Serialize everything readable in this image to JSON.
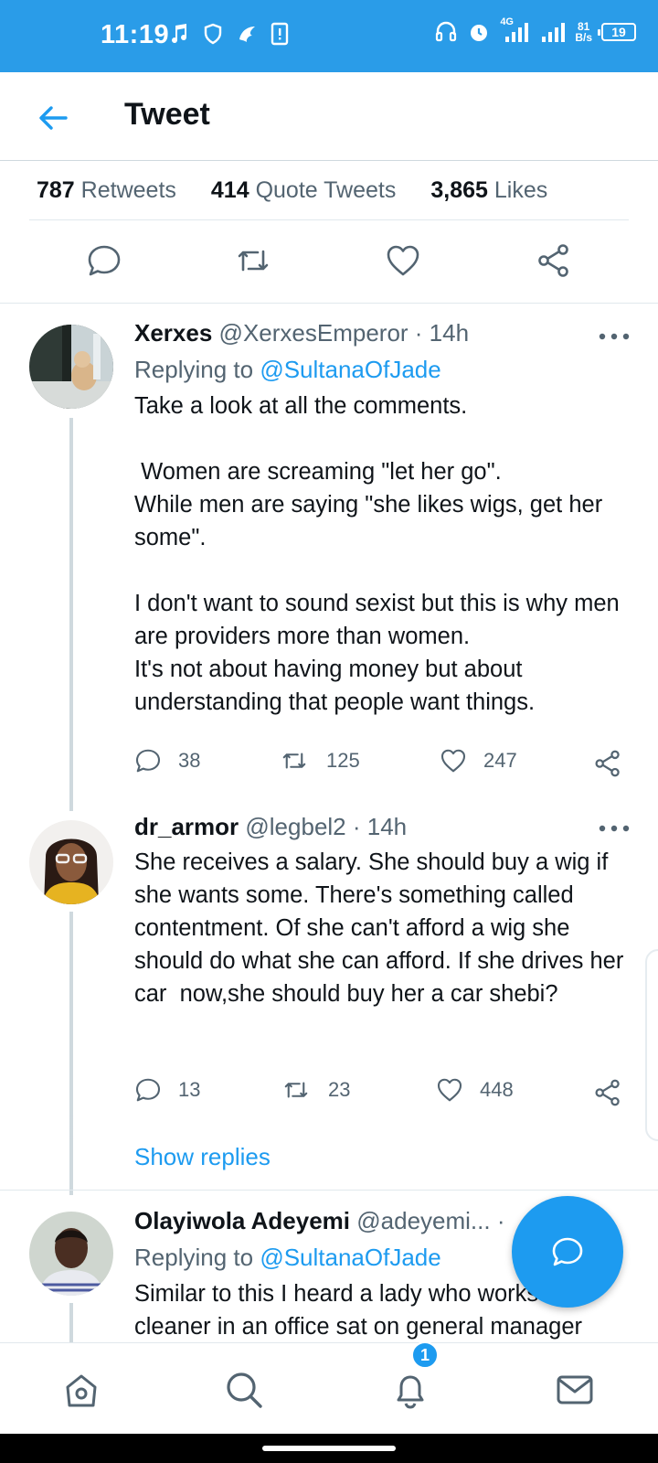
{
  "status_bar": {
    "time": "11:19",
    "network_speed_value": "81",
    "network_speed_unit": "B/s",
    "network_type": "4G",
    "battery": "19",
    "icons": [
      "music-note-icon",
      "shield-icon",
      "app-icon",
      "phone-alert-icon",
      "headset-icon",
      "alarm-icon",
      "signal-icon",
      "signal-icon"
    ]
  },
  "header": {
    "title": "Tweet",
    "back_icon": "arrow-left-icon"
  },
  "stats": [
    {
      "value": "787",
      "label": "Retweets"
    },
    {
      "value": "414",
      "label": "Quote Tweets"
    },
    {
      "value": "3,865",
      "label": "Likes"
    }
  ],
  "actions": [
    "reply-icon",
    "retweet-icon",
    "like-icon",
    "share-icon"
  ],
  "tweets": [
    {
      "name": "Xerxes",
      "meta": "@XerxesEmperor · 14h",
      "replying_prefix": "Replying to",
      "replying_handle": "@SultanaOfJade",
      "text": "Take a look at all the comments.\n\n Women are screaming \"let her go\".\nWhile men are saying \"she likes wigs, get her some\".\n\nI don't want to sound sexist but this is why men are providers more than women.\nIt's not about having money but about understanding that people want things.",
      "replies": "38",
      "retweets": "125",
      "likes": "247"
    },
    {
      "name": "dr_armor",
      "meta": "@legbel2 · 14h",
      "text": "She receives a salary. She should buy a wig if she wants some. There's something called contentment. Of she can't afford a wig she should do what she can afford. If she drives her car  now,she should buy her a car shebi?",
      "replies": "13",
      "retweets": "23",
      "likes": "448",
      "show_replies": "Show replies"
    },
    {
      "name": "Olayiwola Adeyemi",
      "meta": "@adeyemi...",
      "meta_suffix": "·",
      "replying_prefix": "Replying to",
      "replying_handle": "@SultanaOfJade",
      "text": "Similar to this I heard a lady who works\ncleaner in an office sat on general manager"
    }
  ],
  "nav": {
    "items": [
      "home-icon",
      "search-icon",
      "notifications-icon",
      "messages-icon"
    ],
    "notification_count": "1"
  },
  "colors": {
    "accent": "#1d9bf0",
    "status_bar": "#2a9ce8",
    "secondary_text": "#536471"
  }
}
